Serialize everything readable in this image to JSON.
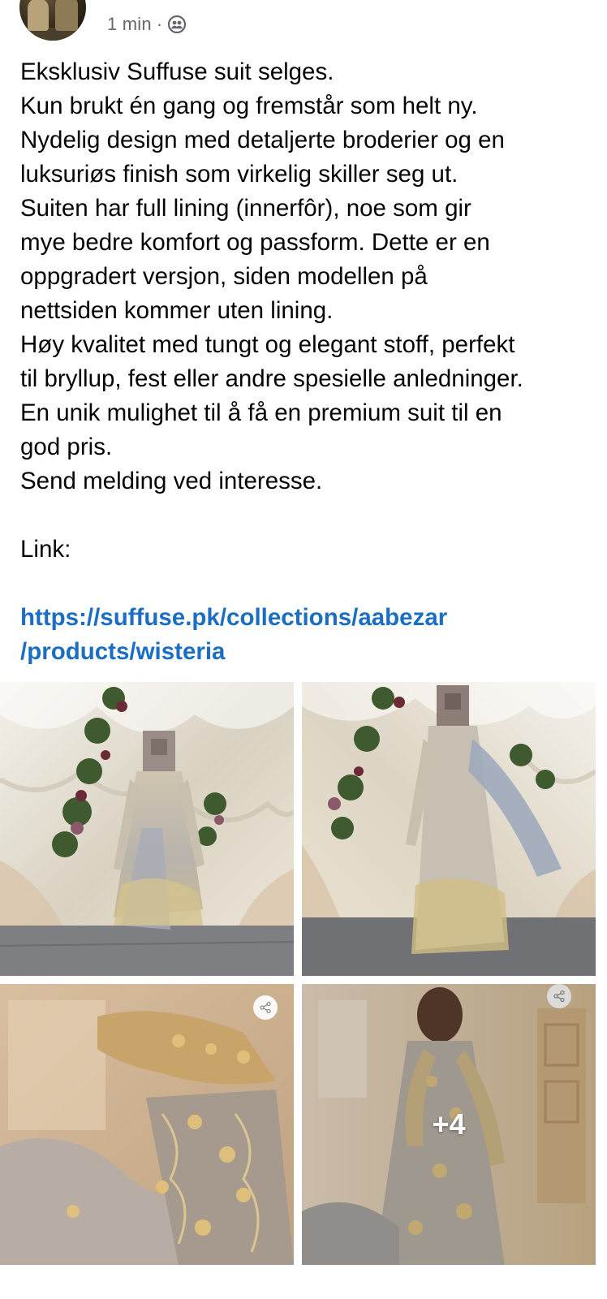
{
  "post": {
    "time": "1 min",
    "separator": "·",
    "privacy_icon": "friends-icon",
    "lines": [
      "Eksklusiv Suffuse suit selges.",
      "Kun brukt én gang og fremstår som helt ny.",
      "Nydelig design med detaljerte broderier og en",
      "luksuriøs finish som virkelig skiller seg ut.",
      "Suiten har full lining (innerfôr), noe som gir",
      "mye bedre komfort og passform. Dette er en",
      "oppgradert versjon, siden modellen på",
      "nettsiden kommer uten lining.",
      "Høy kvalitet med tungt og elegant stoff, perfekt",
      "til bryllup, fest eller andre spesielle anledninger.",
      "En unik mulighet til å få en premium suit til en",
      "god pris.",
      "Send melding ved interesse."
    ],
    "link_label": "Link:",
    "link_lines": [
      "https://suffuse.pk/collections/aabezar",
      "/products/wisteria"
    ]
  },
  "photos": {
    "more_count": "+4",
    "accent_link_color": "#1b6ec2"
  }
}
